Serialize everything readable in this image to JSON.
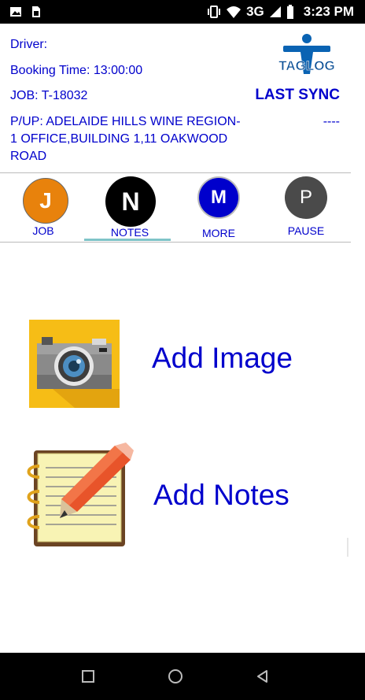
{
  "status_bar": {
    "time": "3:23 PM",
    "network": "3G",
    "icons": [
      "image-icon",
      "sim-icon",
      "vibrate-icon",
      "wifi-icon",
      "signal-icon",
      "battery-icon"
    ]
  },
  "header": {
    "driver": "Driver:",
    "booking_time": "Booking Time: 13:00:00",
    "job": "JOB: T-18032",
    "pickup": "P/UP: ADELAIDE HILLS WINE REGION-1 OFFICE,BUILDING 1,11 OAKWOOD ROAD",
    "logo_text": "TAGLOG",
    "last_sync_label": "LAST SYNC",
    "last_sync_value": "----"
  },
  "tabs": [
    {
      "letter": "J",
      "label": "JOB",
      "color": "#e8820c"
    },
    {
      "letter": "N",
      "label": "NOTES",
      "color": "#000000",
      "active": true
    },
    {
      "letter": "M",
      "label": "MORE",
      "color": "#0000cc"
    },
    {
      "letter": "P",
      "label": "PAUSE",
      "color": "#4a4a4a"
    }
  ],
  "actions": {
    "add_image": "Add Image",
    "add_notes": "Add Notes"
  },
  "colors": {
    "accent_blue": "#0000cc",
    "tab_underline": "#7fc4c8",
    "camera_bg": "#f6bd16"
  }
}
